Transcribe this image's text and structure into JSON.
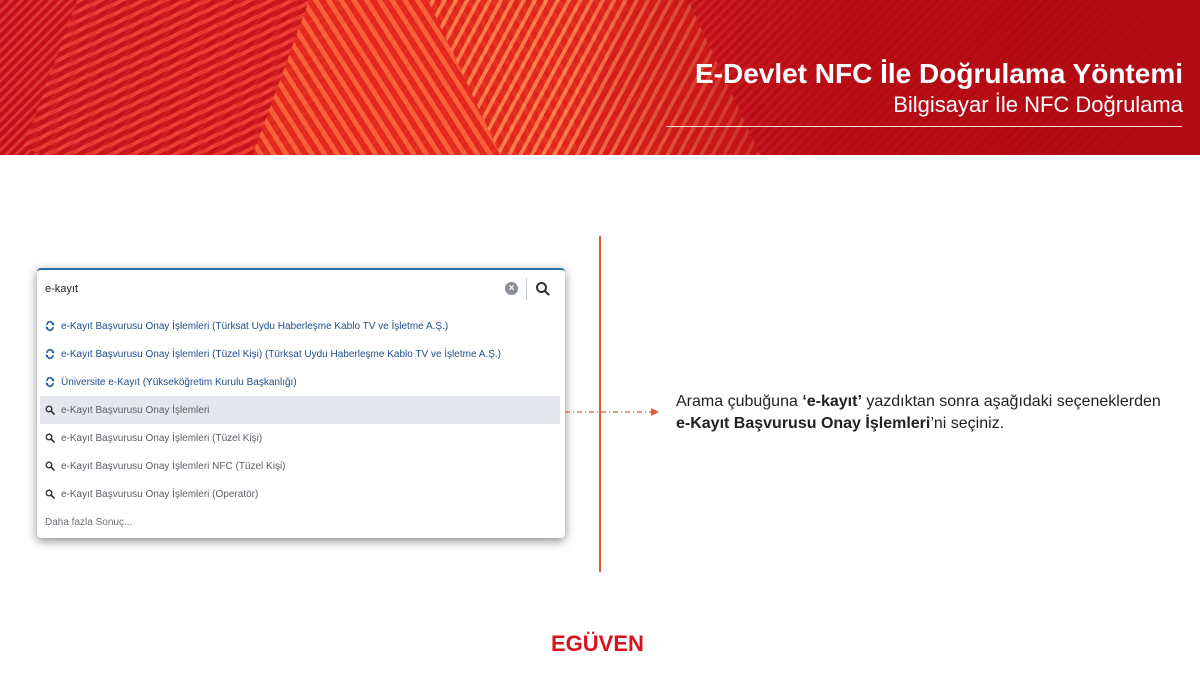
{
  "header": {
    "title": "E-Devlet NFC İle Doğrulama Yöntemi",
    "subtitle": "Bilgisayar İle NFC Doğrulama"
  },
  "search": {
    "query": "e-kayıt",
    "clear_icon": "clear-icon",
    "search_icon": "search-icon"
  },
  "results": {
    "items": [
      {
        "label": "e-Kayıt Başvurusu Onay İşlemleri (Türksat Uydu Haberleşme Kablo TV ve İşletme A.Ş.)",
        "icon": "service-icon"
      },
      {
        "label": "e-Kayıt Başvurusu Onay İşlemleri (Tüzel Kişi) (Türksat Uydu Haberleşme Kablo TV ve İşletme A.Ş.)",
        "icon": "service-icon"
      },
      {
        "label": "Üniversite e-Kayıt (Yükseköğretim Kurulu Başkanlığı)",
        "icon": "service-icon"
      },
      {
        "label": "e-Kayıt Başvurusu Onay İşlemleri",
        "icon": "search-icon"
      },
      {
        "label": "e-Kayıt Başvurusu Onay İşlemleri (Tüzel Kişi)",
        "icon": "search-icon"
      },
      {
        "label": "e-Kayıt Başvurusu Onay İşlemleri NFC (Tüzel Kişi)",
        "icon": "search-icon"
      },
      {
        "label": "e-Kayıt Başvurusu Onay İşlemleri (Operatör)",
        "icon": "search-icon"
      }
    ],
    "more": "Daha fazla Sonuç..."
  },
  "instruction": {
    "p1": "Arama çubuğuna ",
    "b1": "‘e-kayıt’",
    "p2": " yazdıktan sonra aşağıdaki seçeneklerden ",
    "b2": "e-Kayıt Başvurusu Onay İşlemleri",
    "p3": "’ni seçiniz."
  },
  "logo": "EGÜVEN",
  "colors": {
    "brand_red": "#d7141d",
    "link_blue": "#1f4e8c",
    "divider_orange": "#e25a36",
    "selected_bg": "#e4e7eb"
  }
}
